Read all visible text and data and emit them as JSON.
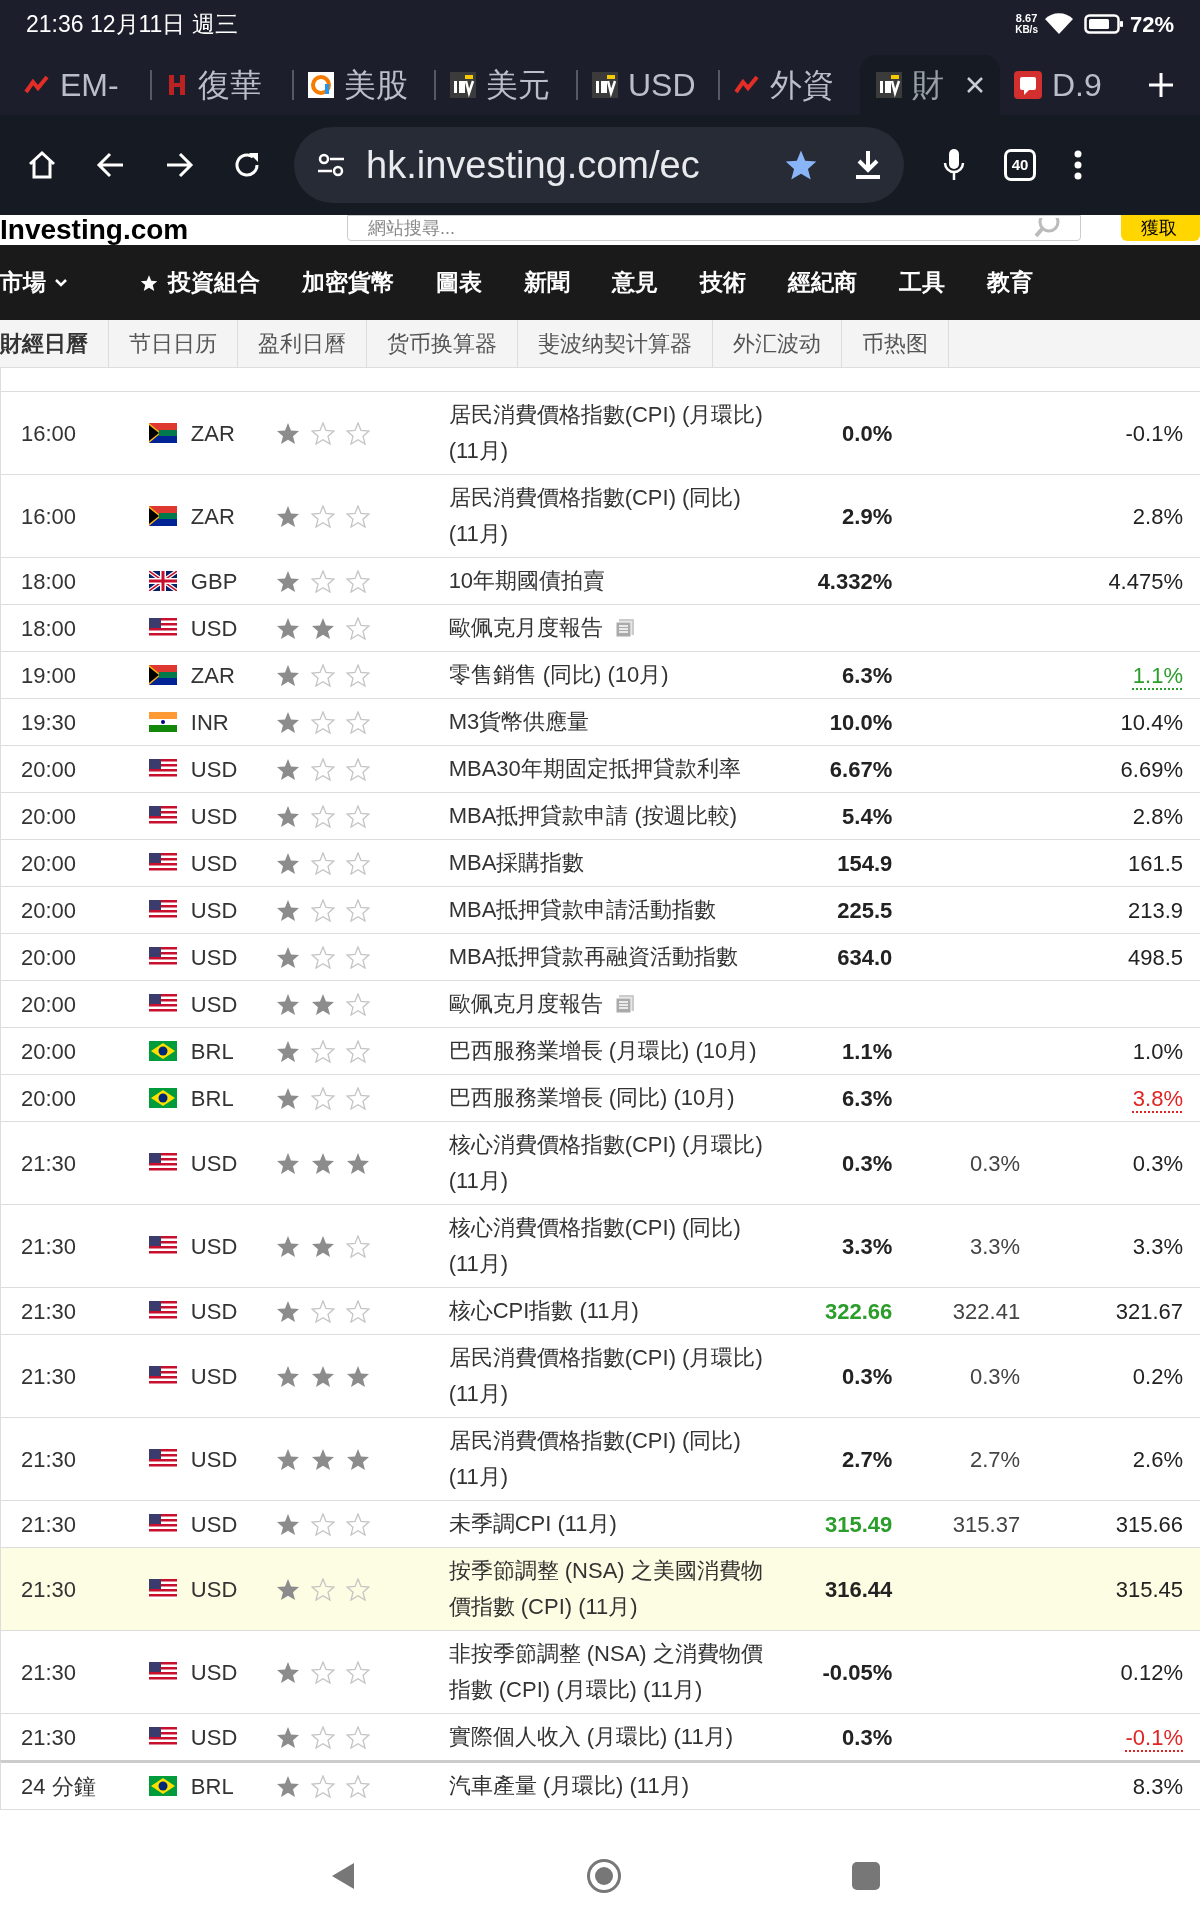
{
  "status_bar": {
    "time": "21:36 12月11日 週三",
    "net_speed": "8.67",
    "net_unit": "KB/s",
    "battery": "72%"
  },
  "browser_tabs": [
    {
      "label": "EM-",
      "selected": false
    },
    {
      "label": "復華",
      "selected": false
    },
    {
      "label": "美股",
      "selected": false
    },
    {
      "label": "美元",
      "selected": false
    },
    {
      "label": "USD",
      "selected": false
    },
    {
      "label": "外資",
      "selected": false
    },
    {
      "label": "財",
      "selected": true
    },
    {
      "label": "D.9",
      "selected": false
    }
  ],
  "toolbar": {
    "url": "hk.investing.com/ec",
    "tab_count": "40"
  },
  "site_header": {
    "logo": "Investing.com",
    "search_placeholder": "網站搜尋...",
    "button": "獲取"
  },
  "nav": [
    {
      "label": "市場",
      "kind": "dropdown"
    },
    {
      "label": "投資組合",
      "kind": "starred"
    },
    {
      "label": "加密貨幣",
      "kind": "plain"
    },
    {
      "label": "圖表",
      "kind": "plain"
    },
    {
      "label": "新聞",
      "kind": "plain"
    },
    {
      "label": "意見",
      "kind": "plain"
    },
    {
      "label": "技術",
      "kind": "plain"
    },
    {
      "label": "經紀商",
      "kind": "plain"
    },
    {
      "label": "工具",
      "kind": "plain"
    },
    {
      "label": "教育",
      "kind": "plain"
    }
  ],
  "subnav": [
    {
      "label": "財經日曆",
      "selected": true
    },
    {
      "label": "节日日历",
      "selected": false
    },
    {
      "label": "盈利日曆",
      "selected": false
    },
    {
      "label": "货币换算器",
      "selected": false
    },
    {
      "label": "斐波纳契计算器",
      "selected": false
    },
    {
      "label": "外汇波动",
      "selected": false
    },
    {
      "label": "币热图",
      "selected": false
    }
  ],
  "events": [
    {
      "time": "16:00",
      "kind": "za",
      "currency": "ZAR",
      "stars": 1,
      "event": "居民消費價格指數(CPI) (月環比) (11月)",
      "actual": "0.0%",
      "previous": "-0.1%"
    },
    {
      "time": "16:00",
      "kind": "za",
      "currency": "ZAR",
      "stars": 1,
      "event": "居民消費價格指數(CPI) (同比) (11月)",
      "actual": "2.9%",
      "previous": "2.8%"
    },
    {
      "time": "18:00",
      "kind": "gb",
      "currency": "GBP",
      "stars": 1,
      "event": "10年期國債拍賣",
      "actual": "4.332%",
      "previous": "4.475%"
    },
    {
      "time": "18:00",
      "kind": "us",
      "currency": "USD",
      "stars": 2,
      "event": "歐佩克月度報告",
      "report": true
    },
    {
      "time": "19:00",
      "kind": "za",
      "currency": "ZAR",
      "stars": 1,
      "event": "零售銷售 (同比) (10月)",
      "actual": "6.3%",
      "previous": {
        "text": "1.1%",
        "color": "#2a9d2a"
      }
    },
    {
      "time": "19:30",
      "kind": "in",
      "currency": "INR",
      "stars": 1,
      "event": "M3貨幣供應量",
      "actual": "10.0%",
      "previous": "10.4%"
    },
    {
      "time": "20:00",
      "kind": "us",
      "currency": "USD",
      "stars": 1,
      "event": "MBA30年期固定抵押貸款利率",
      "actual": "6.67%",
      "previous": "6.69%"
    },
    {
      "time": "20:00",
      "kind": "us",
      "currency": "USD",
      "stars": 1,
      "event": "MBA抵押貸款申請 (按週比較)",
      "actual": "5.4%",
      "previous": "2.8%"
    },
    {
      "time": "20:00",
      "kind": "us",
      "currency": "USD",
      "stars": 1,
      "event": "MBA採購指數",
      "actual": "154.9",
      "previous": "161.5"
    },
    {
      "time": "20:00",
      "kind": "us",
      "currency": "USD",
      "stars": 1,
      "event": "MBA抵押貸款申請活動指數",
      "actual": "225.5",
      "previous": "213.9"
    },
    {
      "time": "20:00",
      "kind": "us",
      "currency": "USD",
      "stars": 1,
      "event": "MBA抵押貸款再融資活動指數",
      "actual": "634.0",
      "previous": "498.5"
    },
    {
      "time": "20:00",
      "kind": "us",
      "currency": "USD",
      "stars": 2,
      "event": "歐佩克月度報告",
      "report": true
    },
    {
      "time": "20:00",
      "kind": "br",
      "currency": "BRL",
      "stars": 1,
      "event": "巴西服務業增長 (月環比) (10月)",
      "actual": "1.1%",
      "previous": "1.0%"
    },
    {
      "time": "20:00",
      "kind": "br",
      "currency": "BRL",
      "stars": 1,
      "event": "巴西服務業增長 (同比) (10月)",
      "actual": "6.3%",
      "previous": {
        "text": "3.8%",
        "color": "#e02424"
      }
    },
    {
      "time": "21:30",
      "kind": "us",
      "currency": "USD",
      "stars": 3,
      "event": "核心消費價格指數(CPI) (月環比) (11月)",
      "actual": "0.3%",
      "forecast": "0.3%",
      "previous": "0.3%"
    },
    {
      "time": "21:30",
      "kind": "us",
      "currency": "USD",
      "stars": 2,
      "event": "核心消費價格指數(CPI) (同比) (11月)",
      "actual": "3.3%",
      "forecast": "3.3%",
      "previous": "3.3%"
    },
    {
      "time": "21:30",
      "kind": "us",
      "currency": "USD",
      "stars": 1,
      "event": "核心CPI指數 (11月)",
      "actual": {
        "text": "322.66",
        "color": "#2a9d2a"
      },
      "forecast": "322.41",
      "previous": "321.67"
    },
    {
      "time": "21:30",
      "kind": "us",
      "currency": "USD",
      "stars": 3,
      "event": "居民消費價格指數(CPI) (月環比) (11月)",
      "actual": "0.3%",
      "forecast": "0.3%",
      "previous": "0.2%"
    },
    {
      "time": "21:30",
      "kind": "us",
      "currency": "USD",
      "stars": 3,
      "event": "居民消費價格指數(CPI) (同比) (11月)",
      "actual": "2.7%",
      "forecast": "2.7%",
      "previous": "2.6%"
    },
    {
      "time": "21:30",
      "kind": "us",
      "currency": "USD",
      "stars": 1,
      "event": "未季調CPI (11月)",
      "actual": {
        "text": "315.49",
        "color": "#2a9d2a"
      },
      "forecast": "315.37",
      "previous": "315.66"
    },
    {
      "time": "21:30",
      "kind": "us",
      "currency": "USD",
      "stars": 1,
      "event": "按季節調整 (NSA) 之美國消費物價指數 (CPI) (11月)",
      "actual": "316.44",
      "previous": "315.45",
      "highlighted": true
    },
    {
      "time": "21:30",
      "kind": "us",
      "currency": "USD",
      "stars": 1,
      "event": "非按季節調整 (NSA) 之消費物價指數 (CPI) (月環比) (11月)",
      "actual": "-0.05%",
      "previous": "0.12%"
    },
    {
      "time": "21:30",
      "kind": "us",
      "currency": "USD",
      "stars": 1,
      "event": "實際個人收入 (月環比) (11月)",
      "actual": "0.3%",
      "previous": {
        "text": "-0.1%",
        "color": "#e02424"
      }
    },
    {
      "time": "24 分鐘",
      "kind": "br",
      "currency": "BRL",
      "stars": 1,
      "event": "汽車產量 (月環比) (11月)",
      "previous": "8.3%",
      "upcoming": true
    }
  ]
}
